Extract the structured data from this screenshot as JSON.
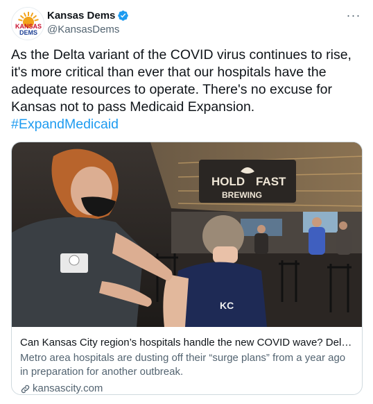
{
  "tweet": {
    "display_name": "Kansas Dems",
    "handle": "@KansasDems",
    "more_label": "···",
    "avatar_text": [
      "KANSAS",
      "DEMS"
    ],
    "text": "As the Delta variant of the COVID virus continues to rise, it's more critical than ever that our hospitals have the adequate resources to operate. There's no excuse for Kansas not to pass Medicaid Expansion.",
    "hashtag": "#ExpandMedicaid",
    "verified_icon": "verified-badge-icon",
    "accent_color": "#1d9bf0"
  },
  "card": {
    "image_sign": [
      "HOLD",
      "FAST",
      "BREWING"
    ],
    "title": "Can Kansas City region’s hospitals handle the new COVID wave? Delta raises…",
    "description": "Metro area hospitals are dusting off their “surge plans” from a year ago in preparation for another outbreak.",
    "domain": "kansascity.com",
    "link_icon": "link-icon"
  }
}
